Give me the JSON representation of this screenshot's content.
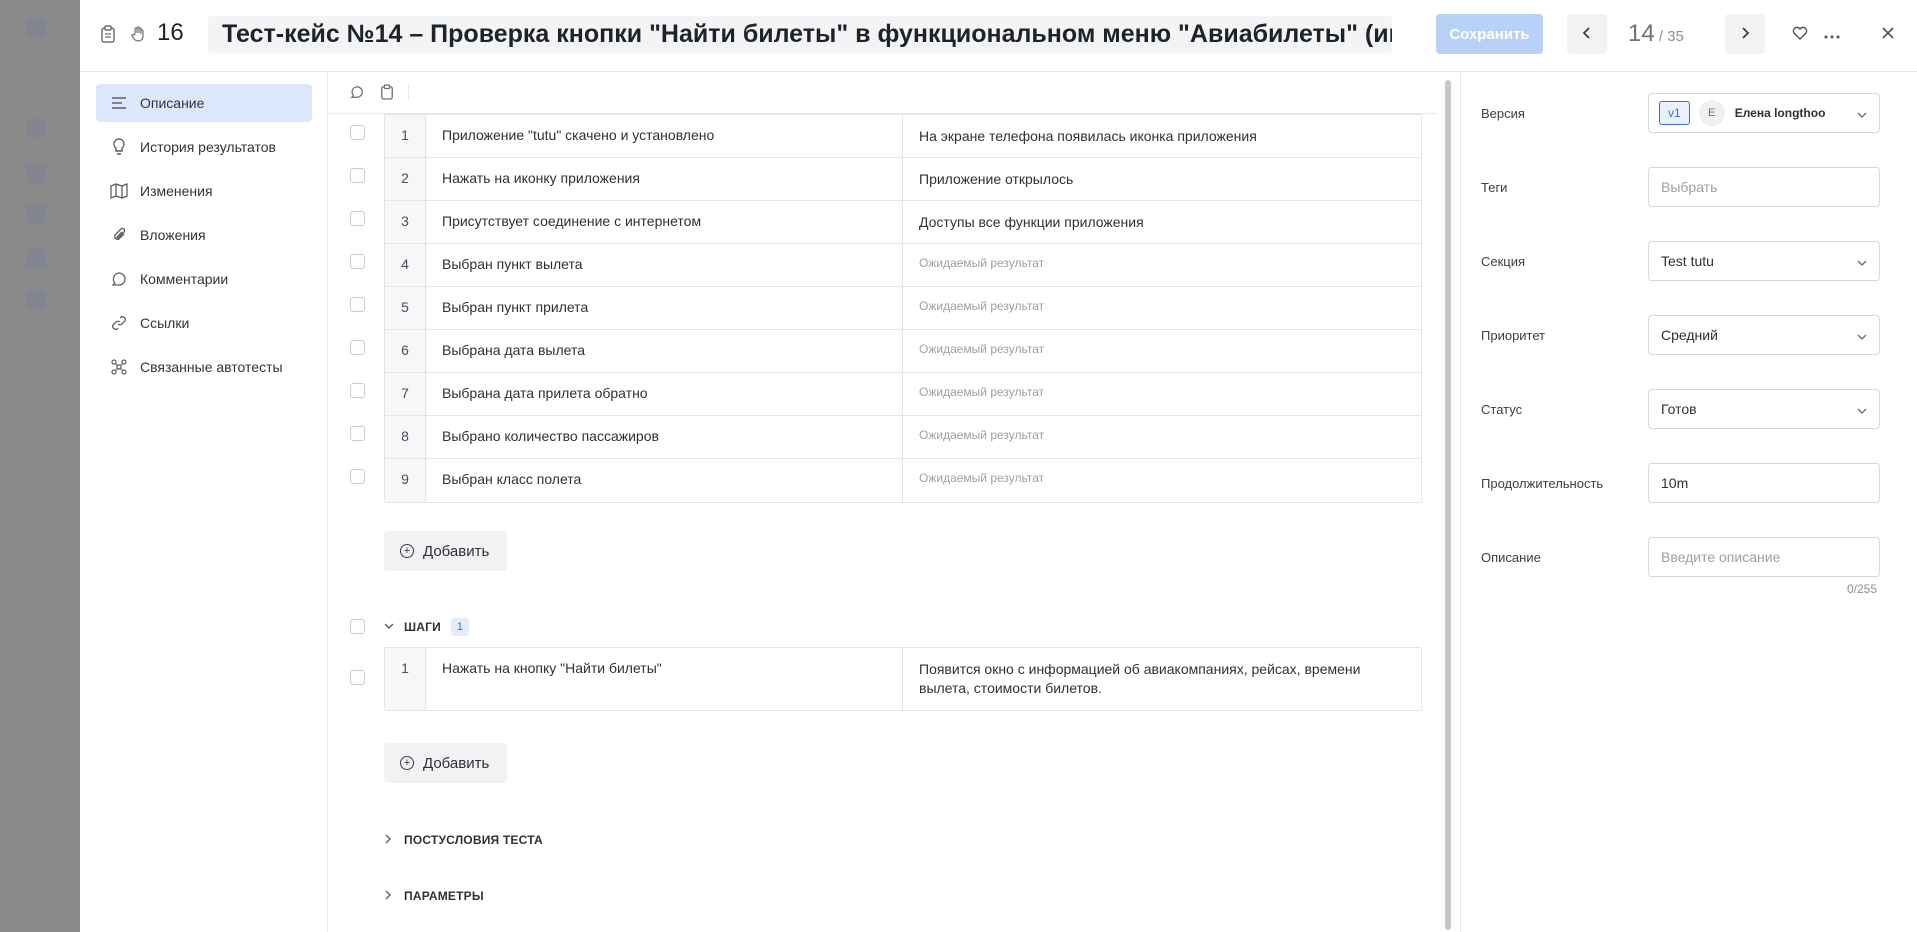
{
  "header": {
    "case_number": "16",
    "title": "Тест-кейс №14 – Проверка кнопки \"Найти билеты\" в функциональном меню \"Авиабилеты\" (интернет соединение присутствует)",
    "save_label": "Сохранить",
    "position_current": "14",
    "position_total": " / 35"
  },
  "left_nav": {
    "items": [
      {
        "label": "Описание",
        "icon": "lines-icon",
        "active": true
      },
      {
        "label": "История результатов",
        "icon": "lightbulb-icon"
      },
      {
        "label": "Изменения",
        "icon": "map-icon"
      },
      {
        "label": "Вложения",
        "icon": "paperclip-icon"
      },
      {
        "label": "Комментарии",
        "icon": "comment-icon"
      },
      {
        "label": "Ссылки",
        "icon": "link-icon"
      },
      {
        "label": "Связанные автотесты",
        "icon": "graph-icon"
      }
    ]
  },
  "preconditions": {
    "rows": [
      {
        "num": "1",
        "step": "Приложение \"tutu\" скачено и установлено",
        "expected": "На экране телефона появилась иконка приложения"
      },
      {
        "num": "2",
        "step": "Нажать на иконку приложения",
        "expected": "Приложение открылось"
      },
      {
        "num": "3",
        "step": "Присутствует соединение с интернетом",
        "expected": "Доступы все функции приложения"
      },
      {
        "num": "4",
        "step": "Выбран пункт вылета",
        "expected": "Ожидаемый результат"
      },
      {
        "num": "5",
        "step": "Выбран пункт прилета",
        "expected": "Ожидаемый результат"
      },
      {
        "num": "6",
        "step": "Выбрана дата вылета",
        "expected": "Ожидаемый результат"
      },
      {
        "num": "7",
        "step": "Выбрана дата прилета обратно",
        "expected": "Ожидаемый результат"
      },
      {
        "num": "8",
        "step": "Выбрано количество пассажиров",
        "expected": "Ожидаемый результат"
      },
      {
        "num": "9",
        "step": "Выбран класс полета",
        "expected": "Ожидаемый результат"
      }
    ],
    "add_label": "Добавить"
  },
  "steps": {
    "title": "ШАГИ",
    "count": "1",
    "rows": [
      {
        "num": "1",
        "step": "Нажать на кнопку \"Найти билеты\"",
        "expected": "Появится окно с информацией об авиакомпаниях, рейсах, времени вылета, стоимости билетов."
      }
    ],
    "add_label": "Добавить"
  },
  "postconditions": {
    "title": "ПОСТУСЛОВИЯ ТЕСТА"
  },
  "parameters": {
    "title": "ПАРАМЕТРЫ"
  },
  "properties": {
    "version_label": "Версия",
    "version_badge": "v1",
    "author_initial": "E",
    "author_name": "Елена longthoo",
    "tags_label": "Теги",
    "tags_placeholder": "Выбрать",
    "section_label": "Секция",
    "section_value": "Test tutu",
    "priority_label": "Приоритет",
    "priority_value": "Средний",
    "status_label": "Статус",
    "status_value": "Готов",
    "duration_label": "Продолжительность",
    "duration_value": "10m",
    "description_label": "Описание",
    "description_placeholder": "Введите описание",
    "description_counter": "0/255"
  }
}
